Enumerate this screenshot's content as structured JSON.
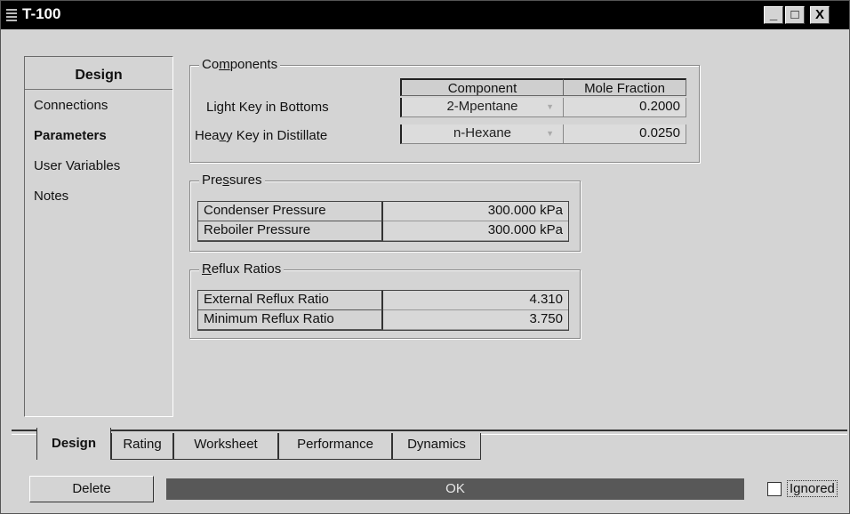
{
  "window": {
    "title": "T-100",
    "minimize": "_",
    "maximize": "□",
    "close": "X"
  },
  "nav": {
    "header": "Design",
    "items": [
      {
        "label": "Connections",
        "bold": false
      },
      {
        "label": "Parameters",
        "bold": true
      },
      {
        "label": "User Variables",
        "bold": false
      },
      {
        "label": "Notes",
        "bold": false
      }
    ]
  },
  "components": {
    "legend_pre": "Co",
    "legend_u": "m",
    "legend_post": "ponents",
    "col_component": "Component",
    "col_mole_fraction": "Mole Fraction",
    "rows": [
      {
        "label_pre": "Light Key in Bottoms",
        "label_u": "",
        "label_post": "",
        "component": "2-Mpentane",
        "mole_fraction": "0.2000"
      },
      {
        "label_pre": "Hea",
        "label_u": "v",
        "label_post": "y Key in Distillate",
        "component": "n-Hexane",
        "mole_fraction": "0.0250"
      }
    ]
  },
  "pressures": {
    "legend_pre": "Pre",
    "legend_u": "s",
    "legend_post": "sures",
    "rows": [
      {
        "label": "Condenser Pressure",
        "value": "300.000 kPa"
      },
      {
        "label": "Reboiler Pressure",
        "value": "300.000 kPa"
      }
    ]
  },
  "reflux": {
    "legend_pre": "",
    "legend_u": "R",
    "legend_post": "eflux Ratios",
    "rows": [
      {
        "label": "External Reflux Ratio",
        "value": "4.310"
      },
      {
        "label": "Minimum Reflux Ratio",
        "value": "3.750"
      }
    ]
  },
  "tabs": [
    "Design",
    "Rating",
    "Worksheet",
    "Performance",
    "Dynamics"
  ],
  "active_tab": "Design",
  "footer": {
    "delete_label": "Delete",
    "status": "OK",
    "ignored_label": "Ignored",
    "ignored_checked": false
  }
}
